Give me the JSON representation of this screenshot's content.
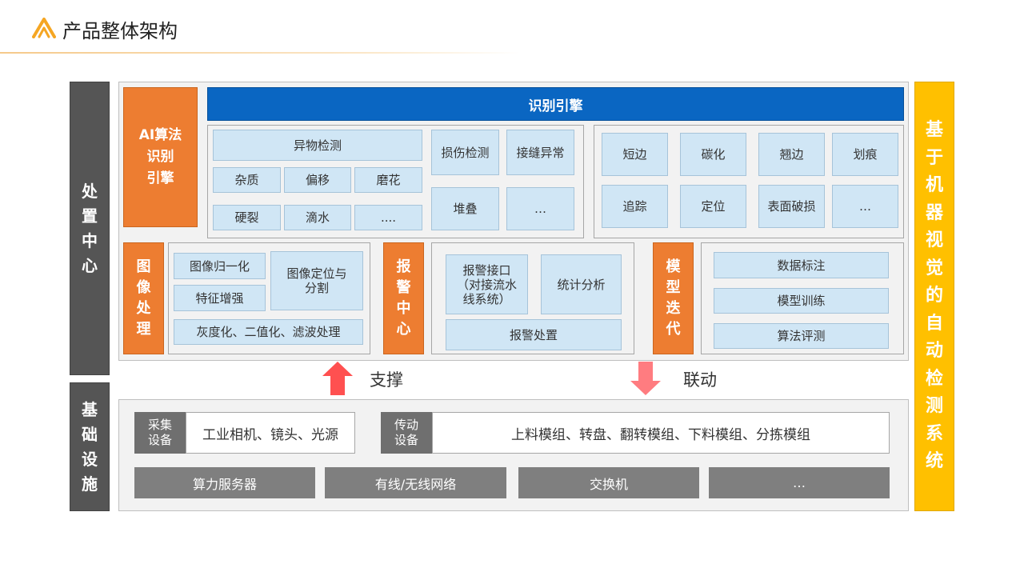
{
  "header": {
    "title": "产品整体架构"
  },
  "sidebar_left": {
    "processing": "处置中心",
    "infrastructure": "基础设施"
  },
  "sidebar_right": {
    "label": "基于机器视觉的自动检测系统"
  },
  "ai_engine": {
    "label_line1": "AI算法",
    "label_line2": "识别",
    "label_line3": "引擎",
    "header": "识别引擎",
    "group1": {
      "foreign_matter": "异物检测",
      "impurity": "杂质",
      "offset": "偏移",
      "grinding": "磨花",
      "crack": "硬裂",
      "drip": "滴水",
      "more1": "....",
      "damage": "损伤检测",
      "seam": "接缝异常",
      "stack": "堆叠",
      "more2": "…"
    },
    "group2": {
      "short_edge": "短边",
      "carbonize": "碳化",
      "warp_edge": "翘边",
      "scratch": "划痕",
      "trace": "追踪",
      "locate": "定位",
      "surface_break": "表面破损",
      "more": "…"
    }
  },
  "image_processing": {
    "label": "图像处理",
    "normalize": "图像归一化",
    "feature_enhance": "特征增强",
    "locate_segment_line1": "图像定位与",
    "locate_segment_line2": "分割",
    "grayscale": "灰度化、二值化、滤波处理"
  },
  "alarm_center": {
    "label": "报警中心",
    "interface_line1": "报警接口",
    "interface_line2": "（对接流水",
    "interface_line3": "线系统）",
    "statistics": "统计分析",
    "handling": "报警处置"
  },
  "model_iteration": {
    "label": "模型迭代",
    "annotation": "数据标注",
    "training": "模型训练",
    "evaluation": "算法评测"
  },
  "arrows": {
    "support": "支撑",
    "linkage": "联动"
  },
  "infrastructure": {
    "capture_label": "采集设备",
    "capture_value": "工业相机、镜头、光源",
    "drive_label": "传动设备",
    "drive_value": "上料模组、转盘、翻转模组、下料模组、分拣模组",
    "compute": "算力服务器",
    "network": "有线/无线网络",
    "switch": "交换机",
    "more": "…"
  },
  "colors": {
    "orange": "#ed7d31",
    "blue": "#0a66c2",
    "cell": "#d0e6f5",
    "dark_gray": "#555555",
    "yellow": "#ffc000",
    "arrow_red": "#ff5050",
    "arrow_pink": "#ff7c80"
  }
}
